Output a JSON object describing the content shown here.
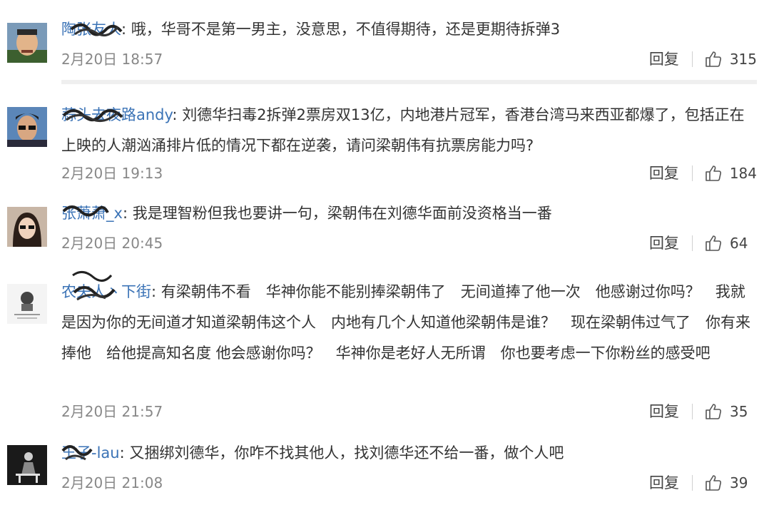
{
  "comments": [
    {
      "username": "陶张友人",
      "text": "哦，华哥不是第一男主，没意思，不值得期待，还是更期待拆弹3",
      "time": "2月20日 18:57",
      "reply": "回复",
      "likes": "315"
    },
    {
      "username": "蒜头去夜路andy",
      "text": "刘德华扫毒2拆弹2票房双13亿，内地港片冠军，香港台湾马来西亚都爆了，包括正在上映的人潮汹涌排片低的情况下都在逆袭，请问梁朝伟有抗票房能力吗?",
      "time": "2月20日 19:13",
      "reply": "回复",
      "likes": "184"
    },
    {
      "username": "张萧萧_x",
      "text": "我是理智粉但我也要讲一句，梁朝伟在刘德华面前没资格当一番",
      "time": "2月20日 20:45",
      "reply": "回复",
      "likes": "64"
    },
    {
      "username": "农夫人丶下街",
      "text": "有梁朝伟不看　华神你能不能别捧梁朝伟了　无间道捧了他一次　他感谢过你吗？　我就是因为你的无间道才知道梁朝伟这个人　内地有几个人知道他梁朝伟是谁？　现在梁朝伟过气了　你有来捧他　给他提高知名度 他会感谢你吗？　华神你是老好人无所谓　你也要考虑一下你粉丝的感受吧",
      "time": "2月20日 21:57",
      "reply": "回复",
      "likes": "35"
    },
    {
      "username": "王子-lau",
      "text": "又捆绑刘德华，你咋不找其他人，找刘德华还不给一番，做个人吧",
      "time": "2月20日 21:08",
      "reply": "回复",
      "likes": "39"
    }
  ],
  "colors": {
    "username": "#3b73b6",
    "text": "#333333",
    "time": "#888888",
    "divider": "#efefef"
  }
}
